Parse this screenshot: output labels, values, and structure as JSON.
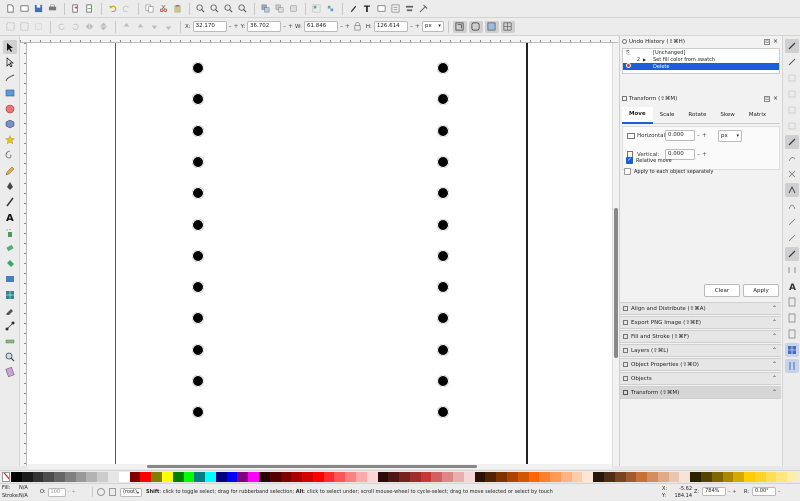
{
  "toolbar": {
    "x_label": "X:",
    "x_value": "32.170",
    "y_label": "Y:",
    "y_value": "36.702",
    "w_label": "W:",
    "w_value": "61.846",
    "h_label": "H:",
    "h_value": "126.614",
    "unit": "px"
  },
  "undo_history": {
    "title": "Undo History (⇧⌘H)",
    "rows": [
      {
        "num": "",
        "label": "[Unchanged]"
      },
      {
        "num": "2",
        "label": "Set fill color from swatch"
      },
      {
        "num": "",
        "label": "Delete"
      }
    ]
  },
  "transform": {
    "title": "Transform (⇧⌘M)",
    "tabs": [
      "Move",
      "Scale",
      "Rotate",
      "Skew",
      "Matrix"
    ],
    "horizontal_label": "Horizontal:",
    "horizontal_value": "0.000",
    "vertical_label": "Vertical:",
    "vertical_value": "0.000",
    "unit": "px",
    "relative_move": "Relative move",
    "apply_each": "Apply to each object separately",
    "clear": "Clear",
    "apply": "Apply"
  },
  "collapsed_panels": [
    "Align and Distribute (⇧⌘A)",
    "Export PNG Image (⇧⌘E)",
    "Fill and Stroke (⇧⌘F)",
    "Layers (⇧⌘L)",
    "Object Properties (⇧⌘O)",
    "Objects",
    "Transform (⇧⌘M)"
  ],
  "statusbar": {
    "fill_label": "Fill:",
    "fill_value": "N/A",
    "stroke_label": "Stroke:",
    "stroke_value": "N/A",
    "opacity_label": "O:",
    "opacity_value": "100",
    "layer": "(root)",
    "hint_shift": "Shift",
    "hint_1": ": click to toggle select; drag for rubberband selection; ",
    "hint_alt": "Alt",
    "hint_2": ": click to select under; scroll mouse-wheel to cycle-select; drag to move selected or select by touch",
    "cx_label": "X:",
    "cx_value": "-5.62",
    "cy_label": "Y:",
    "cy_value": "184.14",
    "zoom_label": "Z:",
    "zoom_value": "784%",
    "rot_label": "R:",
    "rot_value": "0.00°"
  },
  "palette": [
    "#000000",
    "#1a1a1a",
    "#333333",
    "#4d4d4d",
    "#666666",
    "#808080",
    "#999999",
    "#b3b3b3",
    "#cccccc",
    "#e6e6e6",
    "#ffffff",
    "#800000",
    "#ff0000",
    "#808000",
    "#ffff00",
    "#008000",
    "#00ff00",
    "#008080",
    "#00ffff",
    "#000080",
    "#0000ff",
    "#800080",
    "#ff00ff",
    "#2b0000",
    "#550000",
    "#800000",
    "#aa0000",
    "#d40000",
    "#ff0000",
    "#ff2a2a",
    "#ff5555",
    "#ff8080",
    "#ffaaaa",
    "#ffd5d5",
    "#280b0b",
    "#501616",
    "#782121",
    "#a02c2c",
    "#c83737",
    "#d35f5f",
    "#de8787",
    "#e9afaf",
    "#f4d7d7",
    "#2b1100",
    "#552200",
    "#803300",
    "#aa4400",
    "#d45500",
    "#ff6600",
    "#ff7f2a",
    "#ff9955",
    "#ffb380",
    "#ffccaa",
    "#ffe6d5",
    "#28170b",
    "#502d16",
    "#784421",
    "#a05a2c",
    "#c87137",
    "#d38d5f",
    "#deaa87",
    "#e9c6af",
    "#f4e3d7",
    "#2b2200",
    "#554400",
    "#806600",
    "#aa8800",
    "#d4aa00",
    "#ffcc00",
    "#ffd42a",
    "#ffdd55",
    "#ffe680",
    "#ffeeaa"
  ]
}
